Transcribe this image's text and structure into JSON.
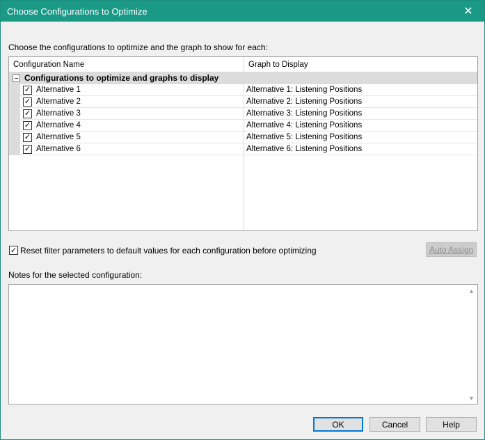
{
  "window": {
    "title": "Choose Configurations to Optimize",
    "close_glyph": "✕"
  },
  "instructions": "Choose the configurations to optimize and the graph to show for each:",
  "grid": {
    "columns": [
      "Configuration Name",
      "Graph to Display"
    ],
    "group_title": "Configurations to optimize and graphs to display",
    "rows": [
      {
        "name": "Alternative 1",
        "graph": "Alternative 1: Listening Positions",
        "checked": true
      },
      {
        "name": "Alternative 2",
        "graph": "Alternative 2: Listening Positions",
        "checked": true
      },
      {
        "name": "Alternative 3",
        "graph": "Alternative 3: Listening Positions",
        "checked": true
      },
      {
        "name": "Alternative 4",
        "graph": "Alternative 4: Listening Positions",
        "checked": true
      },
      {
        "name": "Alternative 5",
        "graph": "Alternative 5: Listening Positions",
        "checked": true
      },
      {
        "name": "Alternative 6",
        "graph": "Alternative 6: Listening Positions",
        "checked": true
      }
    ]
  },
  "reset_checkbox": {
    "label": "Reset filter parameters to default values for each configuration before optimizing",
    "checked": true
  },
  "auto_assign_label": "Auto Assign",
  "notes_label": "Notes for the selected configuration:",
  "notes_value": "",
  "buttons": {
    "ok": "OK",
    "cancel": "Cancel",
    "help": "Help"
  },
  "glyphs": {
    "check": "✓",
    "scroll_up": "▲",
    "scroll_down": "▼"
  },
  "colors": {
    "titlebar": "#1a9987",
    "group_background": "#dcdcdc",
    "default_button_border": "#0078d7"
  }
}
